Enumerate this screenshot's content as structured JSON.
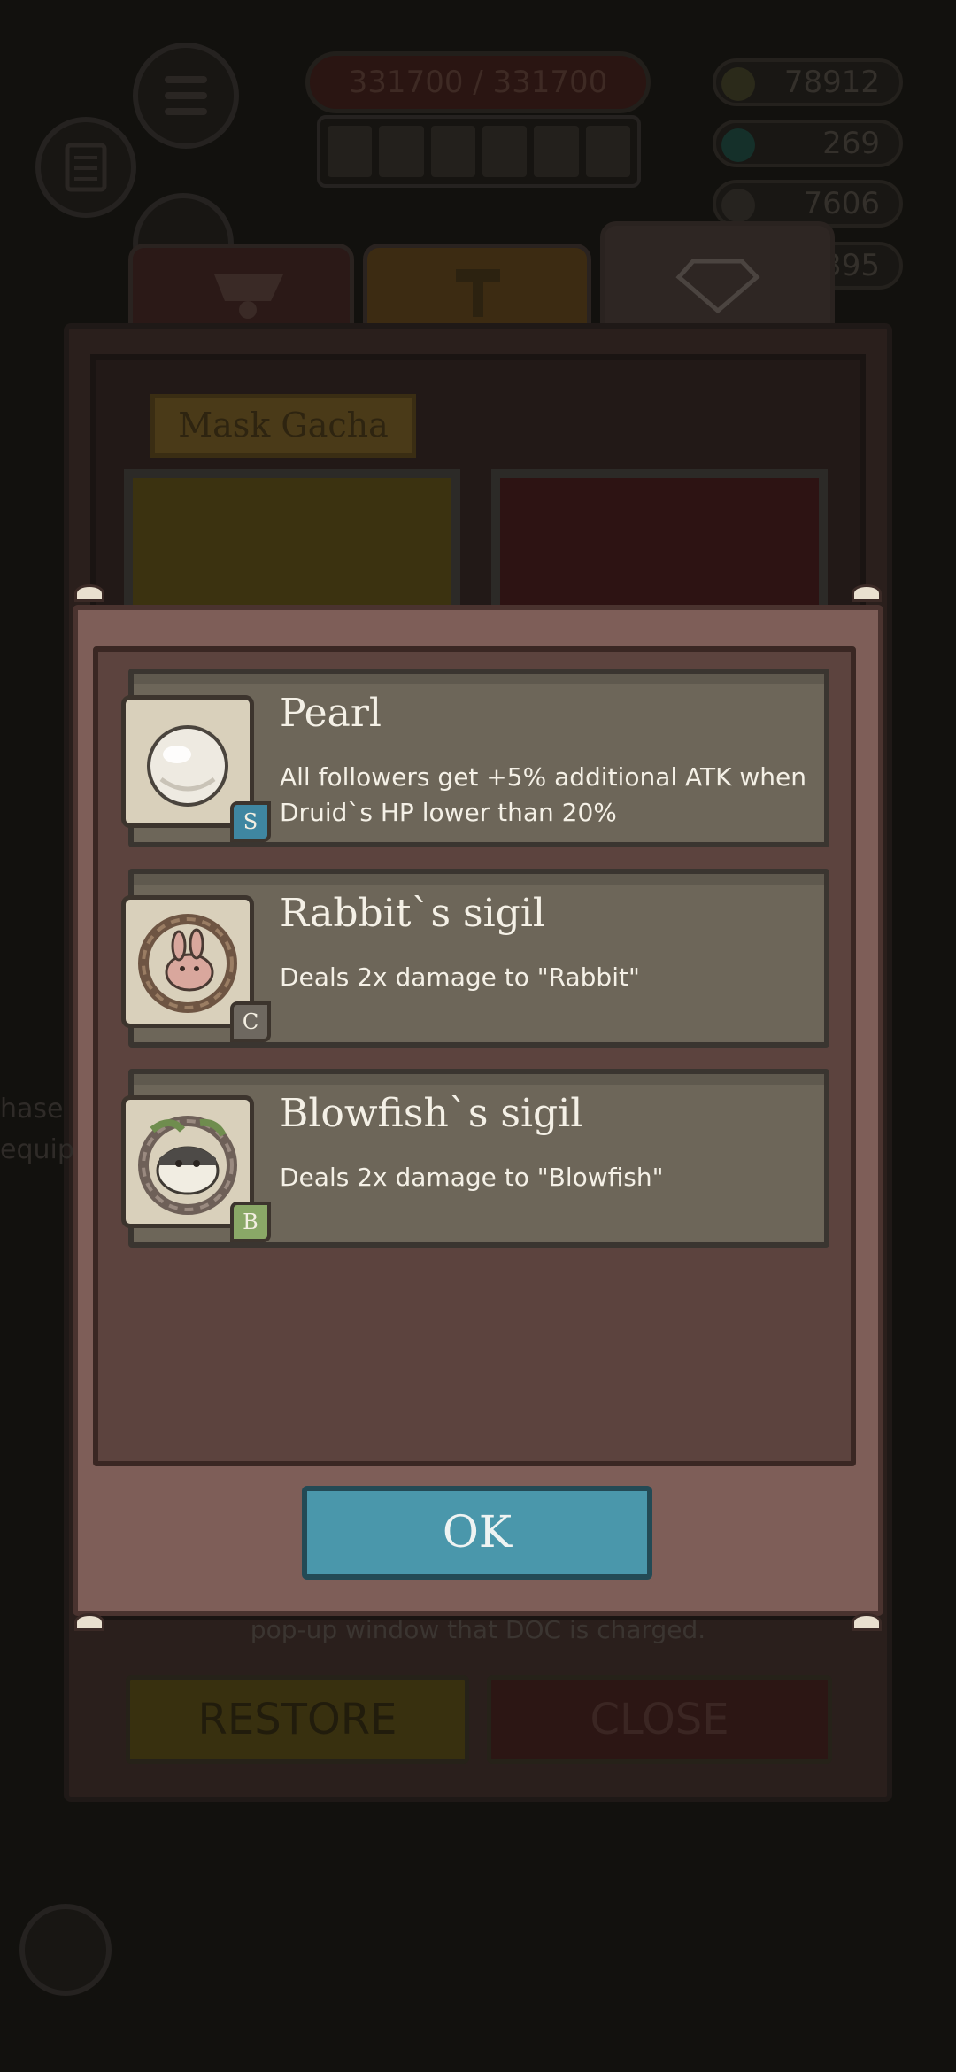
{
  "background": {
    "hp_text": "331700 / 331700",
    "resources": [
      {
        "value": "78912",
        "color": "#2b2a1a"
      },
      {
        "value": "269",
        "color": "#15302a"
      },
      {
        "value": "7606",
        "color": "#26231f"
      },
      {
        "value": "395",
        "color": "#26231f"
      }
    ],
    "shop_tab_label": "Mask Gacha",
    "note_text": "pop-up window that DOC is charged.",
    "side_text_lines": [
      "hase",
      "equip"
    ],
    "restore_label": "RESTORE",
    "close_label": "CLOSE"
  },
  "modal": {
    "items": [
      {
        "title": "Pearl",
        "description": "All followers get +5% additional ATK when Druid`s HP lower than 20%",
        "grade": "S",
        "grade_color": "#3f86a1",
        "icon": "pearl-icon"
      },
      {
        "title": "Rabbit`s sigil",
        "description": "Deals 2x damage to \"Rabbit\"",
        "grade": "C",
        "grade_color": "#6e6860",
        "icon": "rabbit-sigil-icon"
      },
      {
        "title": "Blowfish`s sigil",
        "description": "Deals 2x damage to \"Blowfish\"",
        "grade": "B",
        "grade_color": "#8aa867",
        "icon": "blowfish-sigil-icon"
      }
    ],
    "ok_label": "OK"
  }
}
